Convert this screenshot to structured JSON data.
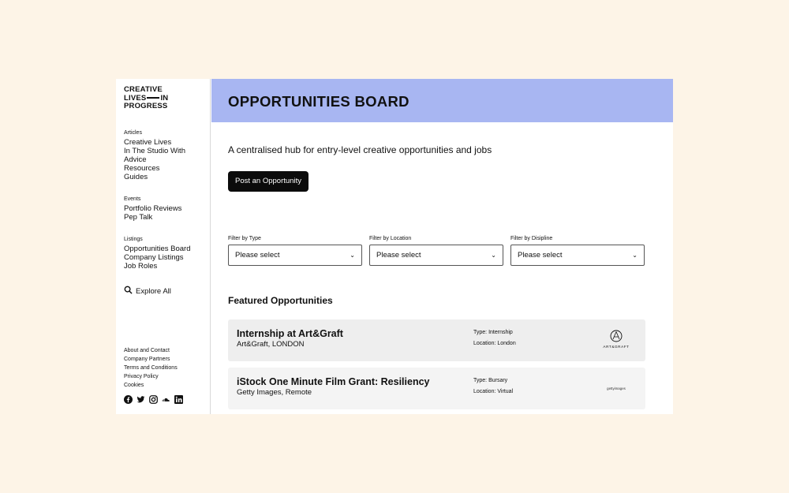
{
  "brand": {
    "line1": "CREATIVE",
    "line2a": "LIVES",
    "line2b": "IN",
    "line3": "PROGRESS"
  },
  "nav": {
    "articles": {
      "heading": "Articles",
      "items": [
        "Creative Lives",
        "In The Studio With",
        "Advice",
        "Resources",
        "Guides"
      ]
    },
    "events": {
      "heading": "Events",
      "items": [
        "Portfolio Reviews",
        "Pep Talk"
      ]
    },
    "listings": {
      "heading": "Listings",
      "items": [
        "Opportunities Board",
        "Company Listings",
        "Job Roles"
      ]
    },
    "explore": "Explore All"
  },
  "footer": {
    "links": [
      "About and Contact",
      "Company Partners",
      "Terms and Conditions",
      "Privacy Policy",
      "Cookies"
    ]
  },
  "socials": [
    "facebook-icon",
    "twitter-icon",
    "instagram-icon",
    "soundcloud-icon",
    "linkedin-icon"
  ],
  "page": {
    "title": "OPPORTUNITIES BOARD",
    "tagline": "A centralised hub for entry-level creative opportunities and jobs",
    "post_button": "Post an Opportunity",
    "banner_color": "#a8b6f2"
  },
  "filters": [
    {
      "label": "Filter by Type",
      "value": "Please select"
    },
    {
      "label": "Filter by Location",
      "value": "Please select"
    },
    {
      "label": "Filter by Disipline",
      "value": "Please select"
    }
  ],
  "featured": {
    "title": "Featured Opportunities",
    "items": [
      {
        "title": "Internship at Art&Graft",
        "company": "Art&Graft, LONDON",
        "type": "Type: Internship",
        "location": "Location: London",
        "logo_text": "ART&GRAFT",
        "bg": "#eeeeee"
      },
      {
        "title": "iStock One Minute Film Grant: Resiliency",
        "company": "Getty Images, Remote",
        "type": "Type: Bursary",
        "location": "Location: Virtual",
        "logo_text": "gettyimages",
        "bg": "#f4f4f4"
      }
    ]
  }
}
